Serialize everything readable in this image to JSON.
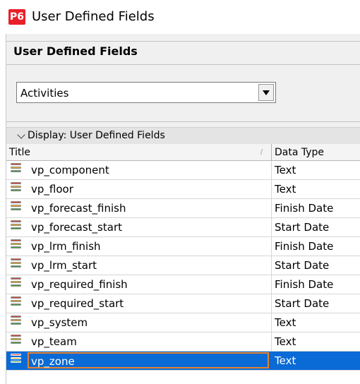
{
  "window": {
    "app_badge": "P6",
    "title": "User Defined Fields"
  },
  "header": {
    "section_title": "User Defined Fields",
    "subject_area": "Activities"
  },
  "display_bar": {
    "label": "Display: User Defined Fields"
  },
  "table": {
    "columns": [
      "Title",
      "Data Type"
    ],
    "rows": [
      {
        "title": "vp_component",
        "data_type": "Text"
      },
      {
        "title": "vp_floor",
        "data_type": "Text"
      },
      {
        "title": "vp_forecast_finish",
        "data_type": "Finish Date"
      },
      {
        "title": "vp_forecast_start",
        "data_type": "Start Date"
      },
      {
        "title": "vp_lrm_finish",
        "data_type": "Finish Date"
      },
      {
        "title": "vp_lrm_start",
        "data_type": "Start Date"
      },
      {
        "title": "vp_required_finish",
        "data_type": "Finish Date"
      },
      {
        "title": "vp_required_start",
        "data_type": "Start Date"
      },
      {
        "title": "vp_system",
        "data_type": "Text"
      },
      {
        "title": "vp_team",
        "data_type": "Text"
      },
      {
        "title": "vp_zone",
        "data_type": "Text"
      }
    ],
    "selected_row": "vp_zone"
  },
  "colors": {
    "app_badge": "#e8202a",
    "selection": "#0a6ad6",
    "edit_border": "#e8822a",
    "icon_red": "#e0443a",
    "icon_yellow": "#f2b51c",
    "icon_green": "#3aa445"
  },
  "icons": {
    "row_icon": "udf-field-icon",
    "dropdown": "chevron-down-icon",
    "display_toggle": "collapse-arrow-icon"
  }
}
